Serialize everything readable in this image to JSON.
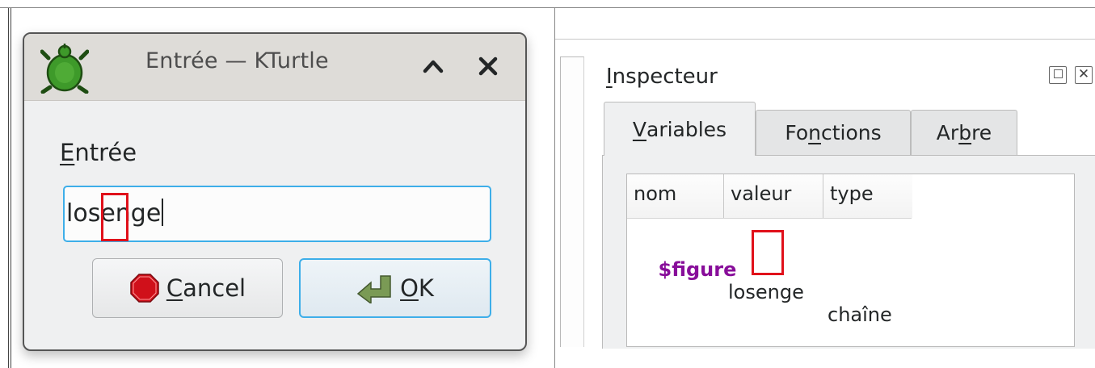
{
  "dialog": {
    "title": "Entrée — KTurtle",
    "label": "Entrée",
    "input_value": "losenge",
    "buttons": {
      "cancel": "Cancel",
      "ok": "OK"
    },
    "icons": {
      "app": "turtle-icon",
      "minimize": "chevron-up-icon",
      "close": "close-icon",
      "cancel": "stop-sign-icon",
      "ok": "check-arrow-icon"
    }
  },
  "inspector": {
    "title": "Inspecteur",
    "tabs": [
      {
        "label": "Variables",
        "active": true
      },
      {
        "label": "Fonctions",
        "active": false
      },
      {
        "label": "Arbre",
        "active": false
      }
    ],
    "columns": [
      "nom",
      "valeur",
      "type"
    ],
    "rows": [
      {
        "nom": "$figure",
        "valeur": "losenge",
        "type": "chaîne"
      }
    ]
  },
  "colors": {
    "focus": "#3daee9",
    "highlight": "#e0101a",
    "variable": "#880e9a"
  }
}
